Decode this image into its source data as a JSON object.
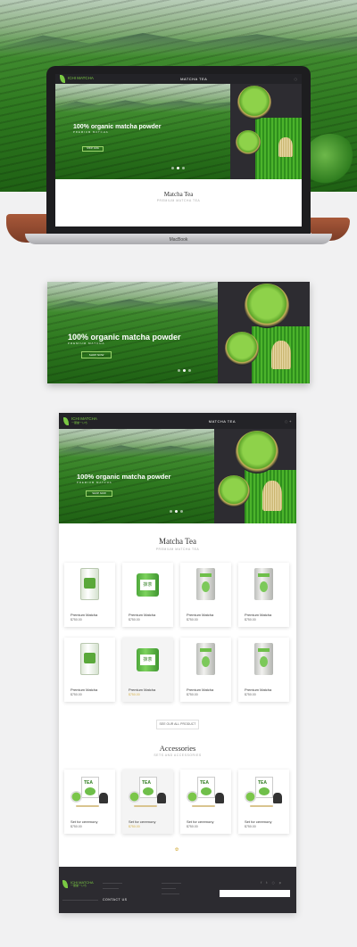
{
  "colors": {
    "brand_green": "#7ac943",
    "dark_bar": "#232327",
    "footer_bg": "#2c2b30",
    "accent_gold": "#d6b24a",
    "page_bg": "#f1f1f2"
  },
  "laptop": {
    "brand": "MacBook"
  },
  "site": {
    "logo_text": "ICHI MATCHA",
    "logo_tagline": "一服堂ーいち",
    "nav_center": "MATCHA TEA",
    "nav_right_icons": [
      "search-icon",
      "cart-icon"
    ]
  },
  "hero": {
    "headline": "100% organic matcha powder",
    "subline": "PREMIUM MATCHA",
    "button": "SHOP NOW",
    "slides": 3,
    "active_slide": 2
  },
  "matcha_section": {
    "title": "Matcha Tea",
    "subtitle": "PREMIUM MATCHA TEA",
    "products": [
      {
        "name": "Premium Matcha",
        "price": "$750.00",
        "image": "white-jar",
        "highlight": false
      },
      {
        "name": "Premium Matcha",
        "price": "$750.00",
        "image": "green-tin",
        "highlight": false
      },
      {
        "name": "Premium Matcha",
        "price": "$750.00",
        "image": "silver-tin",
        "highlight": false
      },
      {
        "name": "Premium Matcha",
        "price": "$750.00",
        "image": "silver-tin",
        "highlight": false
      },
      {
        "name": "Premium Matcha",
        "price": "$750.00",
        "image": "white-jar",
        "highlight": false
      },
      {
        "name": "Premium Matcha",
        "price": "$750.00",
        "image": "green-tin",
        "highlight": true
      },
      {
        "name": "Premium Matcha",
        "price": "$750.00",
        "image": "silver-tin",
        "highlight": false
      },
      {
        "name": "Premium Matcha",
        "price": "$750.00",
        "image": "silver-tin",
        "highlight": false
      }
    ],
    "view_all": "SEE OUR ALL PRODUCT"
  },
  "accessories_section": {
    "title": "Accessories",
    "subtitle": "SETS AND ACCESSORIES",
    "products": [
      {
        "name": "Set for ceremony",
        "price": "$750.00",
        "highlight": false
      },
      {
        "name": "Set for ceremony",
        "price": "$750.00",
        "highlight": true
      },
      {
        "name": "Set for ceremony",
        "price": "$750.00",
        "highlight": false
      },
      {
        "name": "Set for ceremony",
        "price": "$750.00",
        "highlight": false
      }
    ],
    "pager_icon": "leaf-icon"
  },
  "footer": {
    "contact": "CONTACT US",
    "social_icons": [
      "facebook-icon",
      "twitter-icon",
      "instagram-icon",
      "pinterest-icon"
    ]
  }
}
